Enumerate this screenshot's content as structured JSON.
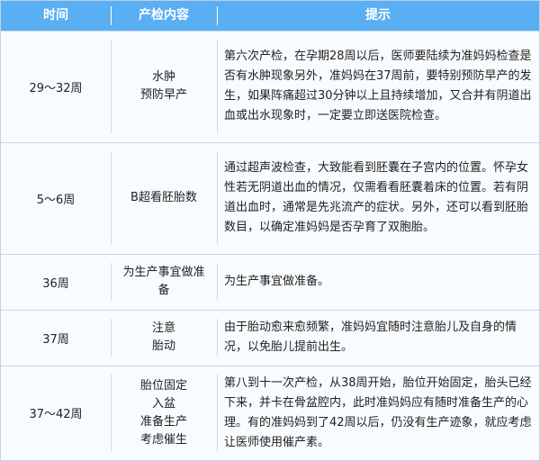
{
  "headers": [
    "时间",
    "产检内容",
    "提示"
  ],
  "rows": [
    {
      "time": "29～32周",
      "content": [
        "水肿",
        "预防早产"
      ],
      "tip": "第六次产检，在孕期28周以后，医师要陆续为准妈妈检查是否有水肿现象另外，准妈妈在37周前，要特别预防早产的发生，如果阵痛超过30分钟以上且持续增加，又合并有阴道出血或出水现象时，一定要立即送医院检查。"
    },
    {
      "time": "5～6周",
      "content": [
        "B超看胚胎数"
      ],
      "tip": "通过超声波检查，大致能看到胚囊在子宫内的位置。怀孕女性若无阴道出血的情况，仅需看看胚囊着床的位置。若有阴道出血时，通常是先兆流产的症状。另外，还可以看到胚胎数目，以确定准妈妈是否孕育了双胞胎。"
    },
    {
      "time": "36周",
      "content": [
        "为生产事宜做准",
        "备"
      ],
      "tip": "为生产事宜做准备。"
    },
    {
      "time": "37周",
      "content": [
        "注意",
        "胎动"
      ],
      "tip": "由于胎动愈来愈频繁，准妈妈宜随时注意胎儿及自身的情况，以免胎儿提前出生。"
    },
    {
      "time": "37～42周",
      "content": [
        "胎位固定",
        "入盆",
        "准备生产",
        "考虑催生"
      ],
      "tip": "第八到十一次产检，从38周开始，胎位开始固定，胎头已经下来，并卡在骨盆腔内，此时准妈妈应有随时准备生产的心理。有的准妈妈到了42周以后，仍没有生产迹象，就应考虑让医师使用催产素。"
    }
  ]
}
